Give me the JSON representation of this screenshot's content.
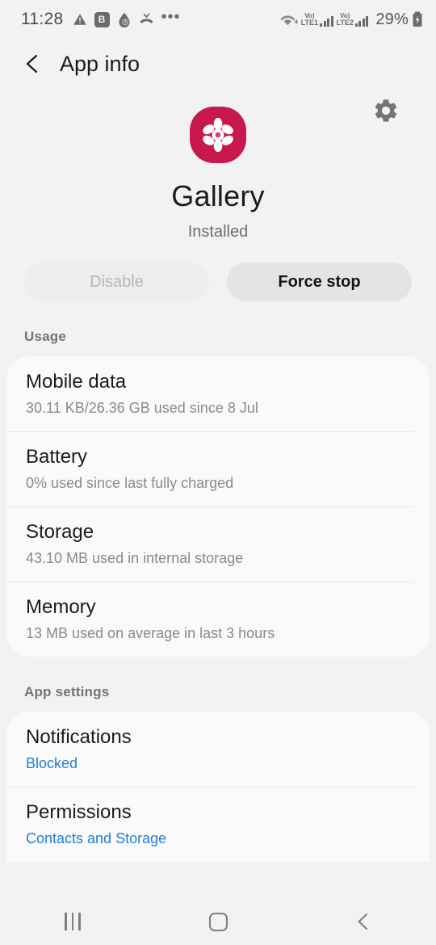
{
  "statusbar": {
    "clock": "11:28",
    "left_icons": [
      "warning-triangle-icon",
      "bixby-b-icon",
      "water-drop-clock-icon",
      "missed-call-icon",
      "more-icons-overflow"
    ],
    "b_badge": "B",
    "overflow": "•••",
    "wifi": "wifi-plus-icon",
    "sim1_vo": "Vo)",
    "sim1_lte": "LTE1",
    "sim2_vo": "Vo)",
    "sim2_lte": "LTE2",
    "battery_percent": "29%",
    "battery_icon": "battery-charging-icon"
  },
  "appbar": {
    "back_icon": "back-chevron-icon",
    "title": "App info"
  },
  "header": {
    "settings_icon": "gear-icon",
    "app_icon": "gallery-flower-icon",
    "app_icon_color": "#C8184E",
    "app_name": "Gallery",
    "install_state": "Installed"
  },
  "actions": {
    "disable_label": "Disable",
    "force_stop_label": "Force stop"
  },
  "usage": {
    "section_label": "Usage",
    "rows": [
      {
        "title": "Mobile data",
        "subtitle": "30.11 KB/26.36 GB used since 8 Jul"
      },
      {
        "title": "Battery",
        "subtitle": "0% used since last fully charged"
      },
      {
        "title": "Storage",
        "subtitle": "43.10 MB used in internal storage"
      },
      {
        "title": "Memory",
        "subtitle": "13 MB used on average in last 3 hours"
      }
    ]
  },
  "app_settings": {
    "section_label": "App settings",
    "rows": [
      {
        "title": "Notifications",
        "subtitle": "Blocked",
        "link": true
      },
      {
        "title": "Permissions",
        "subtitle": "Contacts and Storage",
        "link": true
      }
    ]
  },
  "navbar": {
    "recents_icon": "recents-icon",
    "home_icon": "home-icon",
    "back_icon": "back-icon"
  },
  "colors": {
    "accent_link": "#1e7fd4",
    "app_brand": "#C8184E",
    "background": "#f2f2f2",
    "card": "#fafafa"
  }
}
